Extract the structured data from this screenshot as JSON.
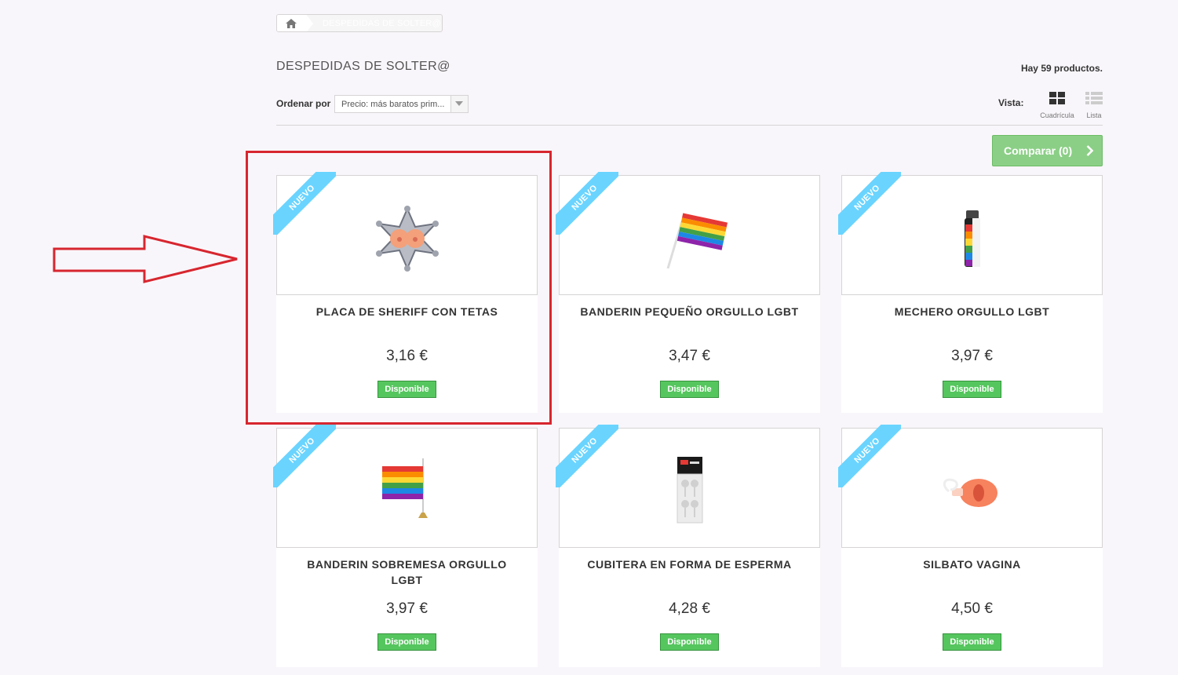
{
  "breadcrumb": {
    "current": "DESPEDIDAS DE SOLTER@"
  },
  "page": {
    "title": "DESPEDIDAS DE SOLTER@",
    "product_count": "Hay 59 productos."
  },
  "sort": {
    "label": "Ordenar por",
    "selected": "Precio: más baratos prim..."
  },
  "view": {
    "label": "Vista:",
    "grid_label": "Cuadrícula",
    "list_label": "Lista"
  },
  "compare": {
    "label": "Comparar (0)"
  },
  "products": [
    {
      "name": "PLACA DE SHERIFF CON TETAS",
      "price": "3,16 €",
      "availability": "Disponible",
      "badge": "NUEVO",
      "icon": "sheriff-badge-icon"
    },
    {
      "name": "BANDERIN PEQUEÑO ORGULLO LGBT",
      "price": "3,47 €",
      "availability": "Disponible",
      "badge": "NUEVO",
      "icon": "rainbow-flag-icon"
    },
    {
      "name": "MECHERO ORGULLO LGBT",
      "price": "3,97 €",
      "availability": "Disponible",
      "badge": "NUEVO",
      "icon": "lighter-icon"
    },
    {
      "name": "BANDERIN SOBREMESA ORGULLO LGBT",
      "price": "3,97 €",
      "availability": "Disponible",
      "badge": "NUEVO",
      "icon": "desk-flag-icon"
    },
    {
      "name": "CUBITERA EN FORMA DE ESPERMA",
      "price": "4,28 €",
      "availability": "Disponible",
      "badge": "NUEVO",
      "icon": "ice-tray-icon"
    },
    {
      "name": "SILBATO VAGINA",
      "price": "4,50 €",
      "availability": "Disponible",
      "badge": "NUEVO",
      "icon": "whistle-icon"
    }
  ],
  "colors": {
    "new_ribbon": "#6ad4ff",
    "available": "#55c65e",
    "compare_button": "#8bcf86",
    "highlight": "#d7262f"
  }
}
